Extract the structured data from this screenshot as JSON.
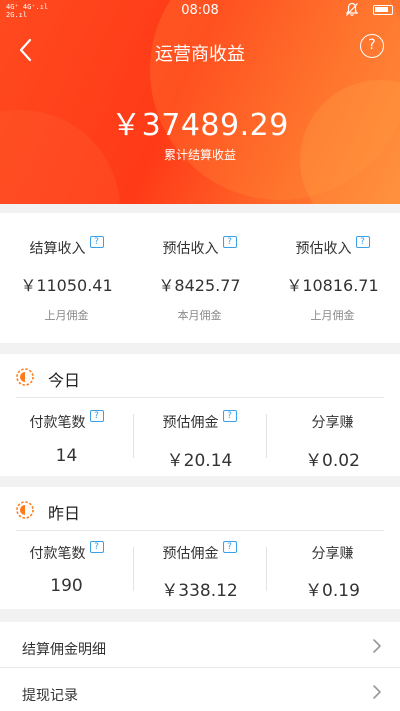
{
  "status_bar": {
    "signal_text_1": "4G⁺ 4G⁺.ıl",
    "signal_text_2": "2G.ıl",
    "time": "08:08"
  },
  "header": {
    "title": "运营商收益",
    "help_icon": "?",
    "total_amount": "￥37489.29",
    "total_label": "累计结算收益"
  },
  "summary": [
    {
      "label": "结算收入",
      "value": "￥11050.41",
      "sub": "上月佣金"
    },
    {
      "label": "预估收入",
      "value": "￥8425.77",
      "sub": "本月佣金"
    },
    {
      "label": "预估收入",
      "value": "￥10816.71",
      "sub": "上月佣金"
    }
  ],
  "today": {
    "title": "今日",
    "items": [
      {
        "label": "付款笔数",
        "value": "14"
      },
      {
        "label": "预估佣金",
        "value": "￥20.14"
      },
      {
        "label": "分享赚",
        "value": "￥0.02"
      }
    ]
  },
  "yesterday": {
    "title": "昨日",
    "items": [
      {
        "label": "付款笔数",
        "value": "190"
      },
      {
        "label": "预估佣金",
        "value": "￥338.12"
      },
      {
        "label": "分享赚",
        "value": "￥0.19"
      }
    ]
  },
  "menu": [
    {
      "label": "结算佣金明细"
    },
    {
      "label": "提现记录"
    }
  ],
  "colors": {
    "accent": "#ff4a1f",
    "info_icon": "#3aa0e8",
    "sun_icon": "#ff7a1a"
  },
  "icons": {
    "back": "chevron-left-icon",
    "help": "question-bubble-icon",
    "info": "info-bubble-icon",
    "sun": "half-sun-icon",
    "row_arrow": "chevron-right-icon"
  }
}
